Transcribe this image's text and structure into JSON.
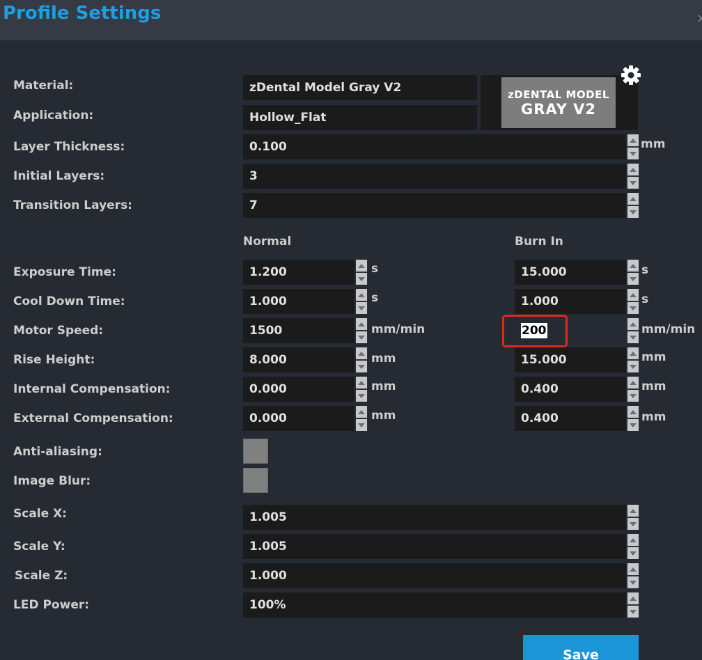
{
  "window": {
    "title": "Profile Settings",
    "close_glyph": "×"
  },
  "profile": {
    "material_label": "Material:",
    "material_value": "zDental Model Gray V2",
    "application_label": "Application:",
    "application_value": "Hollow_Flat",
    "thumbnail_line1": "zDENTAL MODEL",
    "thumbnail_line2": "GRAY V2",
    "settings_icon": "gear-icon"
  },
  "layers": {
    "thickness_label": "Layer Thickness:",
    "thickness_value": "0.100",
    "thickness_unit": "mm",
    "initial_label": "Initial Layers:",
    "initial_value": "3",
    "transition_label": "Transition Layers:",
    "transition_value": "7"
  },
  "columns": {
    "normal": "Normal",
    "burn_in": "Burn In"
  },
  "params": {
    "exposure": {
      "label": "Exposure Time:",
      "normal": "1.200",
      "burn": "15.000",
      "unit": "s"
    },
    "cooldown": {
      "label": "Cool Down Time:",
      "normal": "1.000",
      "burn": "1.000",
      "unit": "s"
    },
    "motor": {
      "label": "Motor Speed:",
      "normal": "1500",
      "burn": "200",
      "unit": "mm/min"
    },
    "rise": {
      "label": "Rise Height:",
      "normal": "8.000",
      "burn": "15.000",
      "unit": "mm"
    },
    "internal": {
      "label": "Internal Compensation:",
      "normal": "0.000",
      "burn": "0.400",
      "unit": "mm"
    },
    "external": {
      "label": "External Compensation:",
      "normal": "0.000",
      "burn": "0.400",
      "unit": "mm"
    }
  },
  "toggles": {
    "antialias_label": "Anti-aliasing:",
    "blur_label": "Image Blur:"
  },
  "scale": {
    "x_label": "Scale X:",
    "x_value": "1.005",
    "y_label": "Scale Y:",
    "y_value": "1.005",
    "z_label": "Scale Z:",
    "z_value": "1.000",
    "led_label": "LED Power:",
    "led_value": "100%"
  },
  "actions": {
    "save_label": "Save"
  },
  "colors": {
    "accent": "#1e9ee3",
    "button": "#1b95d8",
    "annotation": "#e0281e",
    "background": "#262a33"
  }
}
